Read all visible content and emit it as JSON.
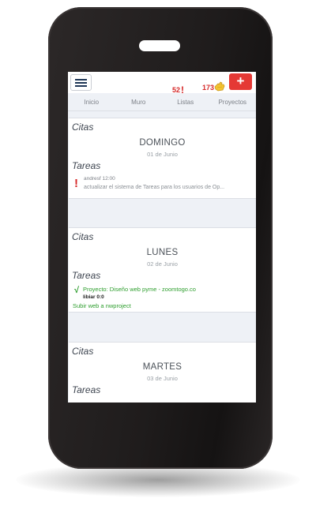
{
  "header": {
    "alert_count": "52",
    "task_count": "173",
    "add_label": "+"
  },
  "tabs": [
    "Inicio",
    "Muro",
    "Listas",
    "Proyectos"
  ],
  "days": [
    {
      "citas_label": "Citas",
      "name": "DOMINGO",
      "date": "01 de Junio",
      "tareas_label": "Tareas",
      "task": {
        "author": "andresf 12:00",
        "text": "actualizar el sistema de Tareas para los usuarios de Op..."
      }
    },
    {
      "citas_label": "Citas",
      "name": "LUNES",
      "date": "02 de Junio",
      "tareas_label": "Tareas",
      "project": {
        "title": "Proyecto: Diseño web pyme - zoomtogo.co",
        "user": "libiar 0:0",
        "link": "Subir web a nwproject"
      }
    },
    {
      "citas_label": "Citas",
      "name": "MARTES",
      "date": "03 de Junio",
      "tareas_label": "Tareas"
    }
  ],
  "colors": {
    "accent_red": "#e53935",
    "success_green": "#2e9e2e",
    "menu_navy": "#1e3656"
  },
  "icons": {
    "alert": "!",
    "check": "√",
    "menu": "hamburger-menu-icon",
    "hand": "pointing-hand-icon"
  }
}
